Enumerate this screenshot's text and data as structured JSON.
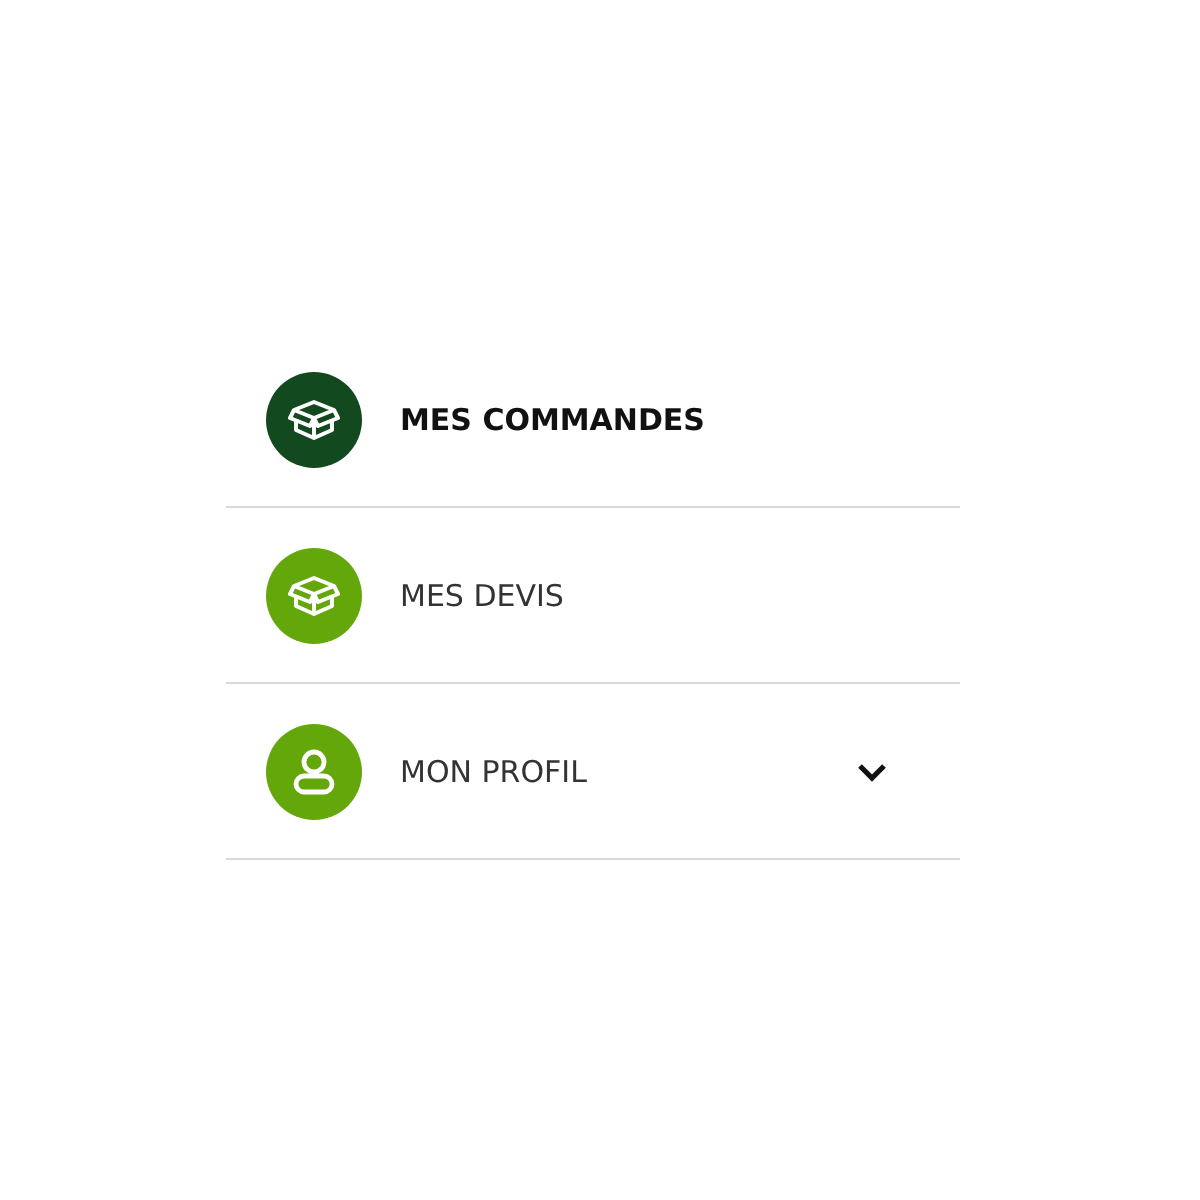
{
  "menu": {
    "items": [
      {
        "label": "MES COMMANDES",
        "kind": "box",
        "selected": true
      },
      {
        "label": "MES DEVIS",
        "kind": "box",
        "selected": false
      },
      {
        "label": "MON PROFIL",
        "kind": "user",
        "selected": false,
        "expanded": false
      }
    ]
  }
}
